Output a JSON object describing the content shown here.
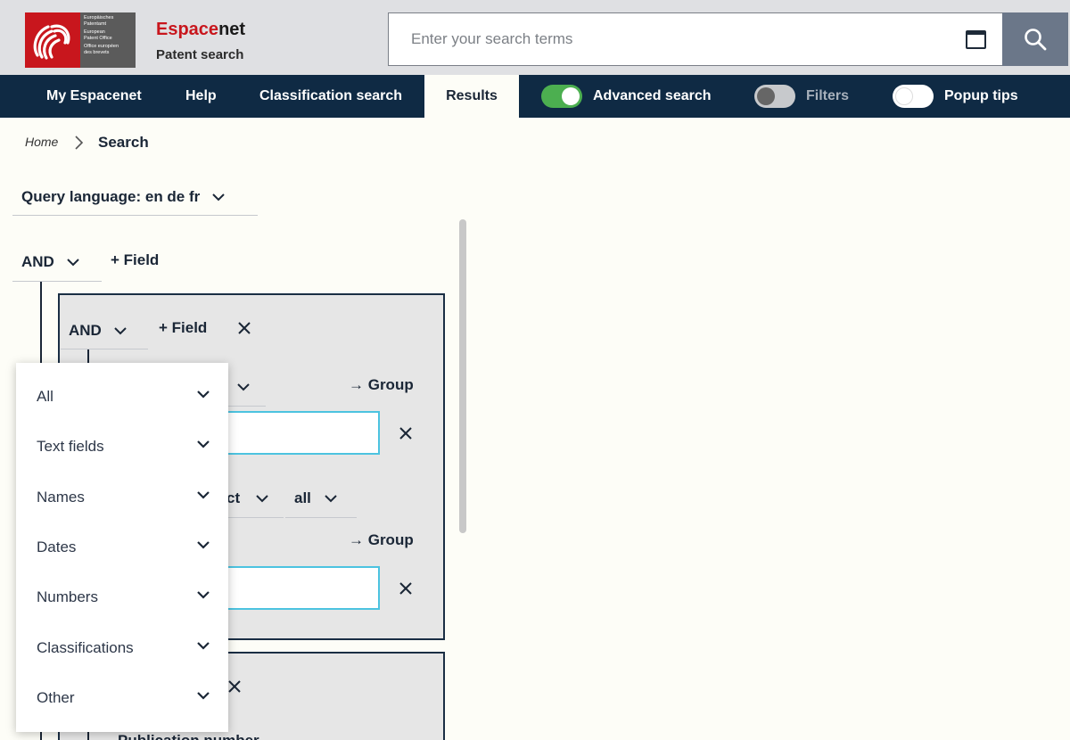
{
  "logo": {
    "lines": [
      "Europäisches",
      "Patentamt",
      "European",
      "Patent Office",
      "Office européen",
      "des brevets"
    ]
  },
  "brand": {
    "name_accent": "Espace",
    "name_rest": "net",
    "subtitle": "Patent search"
  },
  "search": {
    "placeholder": "Enter your search terms"
  },
  "nav": {
    "my_espacenet": "My Espacenet",
    "help": "Help",
    "classification_search": "Classification search",
    "results": "Results",
    "advanced_search": "Advanced search",
    "filters": "Filters",
    "popup_tips": "Popup tips"
  },
  "breadcrumb": {
    "home": "Home",
    "current": "Search"
  },
  "query_language": "Query language: en de fr",
  "builder": {
    "top_operator": "AND",
    "add_field": "+ Field",
    "group1_operator": "AND",
    "group1_add_field": "+ Field",
    "to_group_1": "→ Group",
    "to_group_2": "→ Group",
    "condition_partial": "ct",
    "condition_scope": "all",
    "group2_partial": "Publication number"
  },
  "dropdown": {
    "items": [
      "All",
      "Text fields",
      "Names",
      "Dates",
      "Numbers",
      "Classifications",
      "Other"
    ]
  },
  "colors": {
    "nav_bg": "#0f2a44",
    "brand_red": "#c8161d",
    "toggle_on": "#4caf50",
    "input_border": "#4cc3e0"
  }
}
